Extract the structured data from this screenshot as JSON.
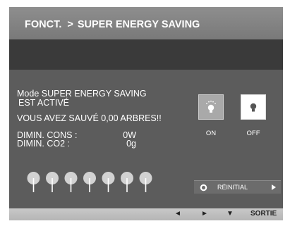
{
  "title": {
    "menu": "FONCT.",
    "separator": ">",
    "section": "SUPER ENERGY SAVING"
  },
  "status": {
    "line1": "Mode SUPER ENERGY SAVING",
    "line2": "EST ACTIVÉ",
    "line3": "VOUS AVEZ SAUVÉ 0,00 ARBRES!!"
  },
  "stats": {
    "power_label": "DIMIN. CONS :",
    "power_value": "0W",
    "co2_label": "DIMIN. CO2 :",
    "co2_value": "0g"
  },
  "options": {
    "on_label": "ON",
    "off_label": "OFF",
    "selected": "ON"
  },
  "trees": {
    "count": 7,
    "icon": "tree-icon"
  },
  "reset": {
    "label": "RÉINITIAL"
  },
  "footer": {
    "left_key": "◄",
    "right_key": "►",
    "down_key": "▼",
    "exit_label": "SORTIE"
  },
  "colors": {
    "osd_background": "#5c5c5c",
    "title_bar": "#8e8e8e",
    "band": "#3a3a3a",
    "selected_button": "#a9a9a9",
    "unselected_button": "#ffffff",
    "footer_bar": "#c8c8c8"
  }
}
